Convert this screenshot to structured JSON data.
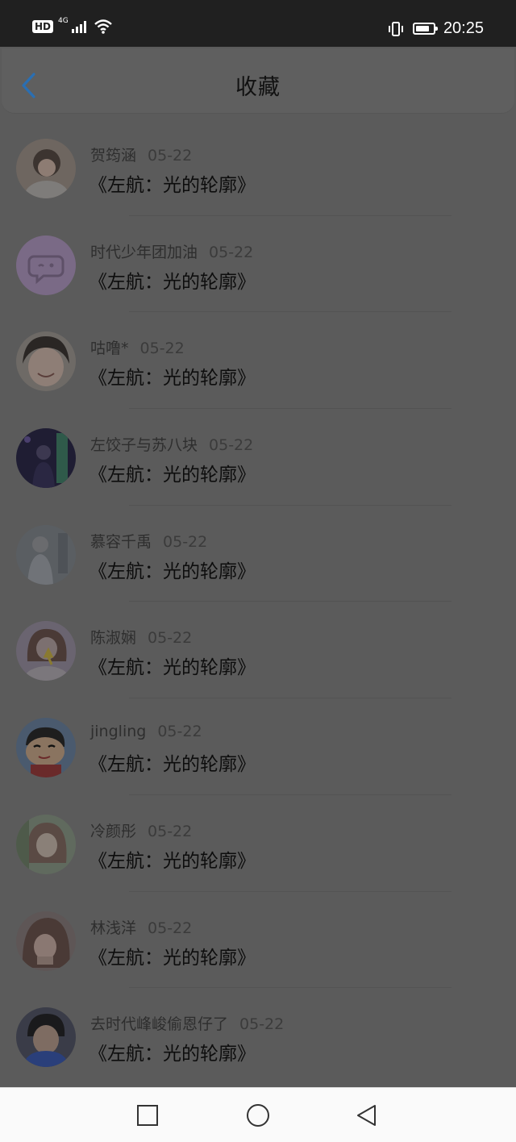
{
  "status_bar": {
    "badge": "HD",
    "network": "4G",
    "time": "20:25",
    "icons": [
      "hd-badge",
      "signal-icon",
      "wifi-icon",
      "vibrate-icon",
      "battery-icon"
    ]
  },
  "header": {
    "title": "收藏",
    "back_icon": "chevron-left-icon"
  },
  "colors": {
    "accent": "#2a6fb3",
    "overlay_background": "#5b5b5b",
    "status_bar": "#202020",
    "nav_bar": "#fafafa"
  },
  "items": [
    {
      "user": "贺筠涵",
      "date": "05-22",
      "book": "《左航：光的轮廓》",
      "avatar": "photo-avatar"
    },
    {
      "user": "时代少年团加油",
      "date": "05-22",
      "book": "《左航：光的轮廓》",
      "avatar": "default-chat-avatar"
    },
    {
      "user": "咕噜*",
      "date": "05-22",
      "book": "《左航：光的轮廓》",
      "avatar": "photo-avatar"
    },
    {
      "user": "左饺子与苏八块",
      "date": "05-22",
      "book": "《左航：光的轮廓》",
      "avatar": "photo-avatar"
    },
    {
      "user": "慕容千禹",
      "date": "05-22",
      "book": "《左航：光的轮廓》",
      "avatar": "photo-avatar"
    },
    {
      "user": "陈淑娴",
      "date": "05-22",
      "book": "《左航：光的轮廓》",
      "avatar": "photo-avatar"
    },
    {
      "user": "jingling",
      "date": "05-22",
      "book": "《左航：光的轮廓》",
      "avatar": "cartoon-avatar"
    },
    {
      "user": "冷颜彤",
      "date": "05-22",
      "book": "《左航：光的轮廓》",
      "avatar": "photo-avatar"
    },
    {
      "user": "林浅洋",
      "date": "05-22",
      "book": "《左航：光的轮廓》",
      "avatar": "photo-avatar"
    },
    {
      "user": "去时代峰峻偷恩仔了",
      "date": "05-22",
      "book": "《左航：光的轮廓》",
      "avatar": "photo-avatar"
    }
  ],
  "nav_bar": {
    "icons": [
      "recents-square-icon",
      "home-circle-icon",
      "back-triangle-icon"
    ]
  }
}
